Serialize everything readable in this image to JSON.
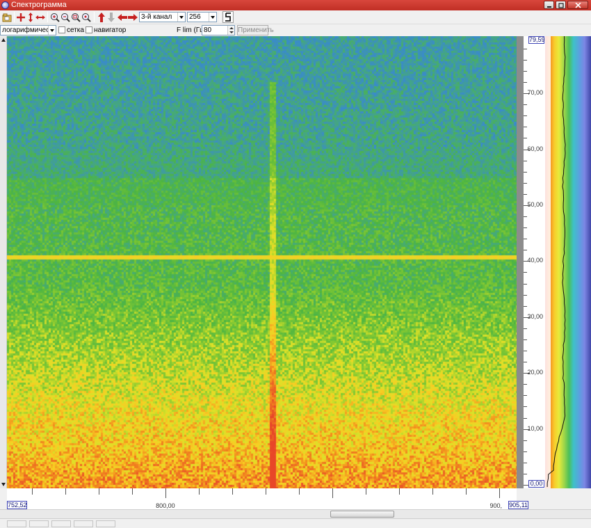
{
  "window": {
    "title": "Спектрограмма",
    "title_bar_color": "#c8382d",
    "controls": [
      "minimize-icon",
      "maximize-icon",
      "close-icon"
    ]
  },
  "toolbar": {
    "icons": [
      "open-file-icon",
      "crosshair-icon",
      "vertical-resize-icon",
      "horizontal-resize-icon",
      "zoom-in-icon",
      "zoom-out-icon",
      "zoom-fit-icon",
      "zoom-reset-icon",
      "arrow-up-icon",
      "arrow-down-icon",
      "arrow-left-icon",
      "arrow-right-icon",
      "letter-s-icon"
    ],
    "channel_select": "3-й канал",
    "fft_size_select": "256"
  },
  "options": {
    "scale_select": "логарифмический",
    "grid_label": "сетка",
    "grid_checked": false,
    "navigator_label": "навигатор",
    "navigator_checked": false,
    "flim_label": "F lim (Гц):",
    "flim_value": "80",
    "apply_label": "Применить",
    "apply_enabled": false
  },
  "y_axis": {
    "max_value": "79,59",
    "min_value": "0,00",
    "tick_labels": [
      "70,00",
      "60,00",
      "50,00",
      "40,00",
      "30,00",
      "20,00",
      "10,00"
    ]
  },
  "x_axis": {
    "start_value": "752,52",
    "end_value": "905,11",
    "tick_labels": [
      "800,00",
      "900,"
    ]
  },
  "spectrogram": {
    "palette": [
      "#4a5ab0",
      "#5b9bd5",
      "#3ec1c8",
      "#4cbf5a",
      "#a8d83c",
      "#f3e62e",
      "#f3b21f",
      "#e8502a"
    ],
    "background_color": "#4db542",
    "horizontal_line_hz": 40.8,
    "vertical_line_at": 832
  }
}
